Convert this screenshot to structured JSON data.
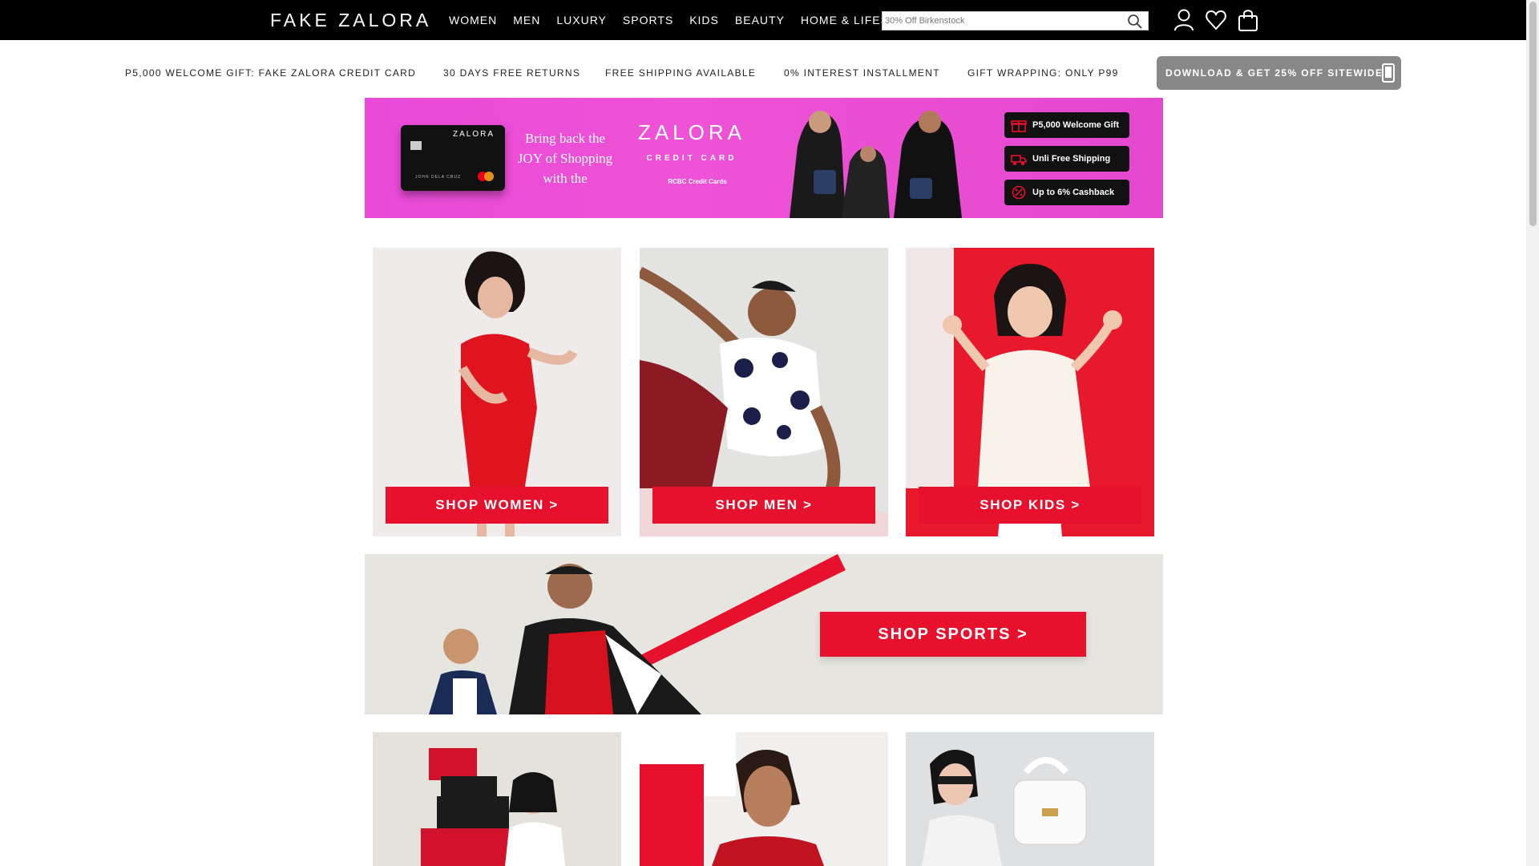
{
  "nav": {
    "logo": "FAKE ZALORA",
    "links": [
      "WOMEN",
      "MEN",
      "LUXURY",
      "SPORTS",
      "KIDS",
      "BEAUTY",
      "HOME & LIFESTYLE"
    ],
    "search_placeholder": "30% Off Birkenstock"
  },
  "usp": {
    "items": [
      "P5,000 WELCOME GIFT: FAKE ZALORA CREDIT CARD",
      "30 DAYS FREE RETURNS",
      "FREE SHIPPING AVAILABLE",
      "0% INTEREST INSTALLMENT",
      "GIFT WRAPPING: ONLY P99"
    ],
    "download_label": "DOWNLOAD & GET 25% OFF SITEWIDE"
  },
  "hero": {
    "card_brand": "ZALORA",
    "card_holder": "JOHN DELA CRUZ",
    "tagline": "Bring back the JOY of Shopping with the",
    "brand": "ZALORA",
    "sub": "CREDIT CARD",
    "bank": "RCBC Credit Cards",
    "perks": [
      "P5,000 Welcome Gift",
      "Unli Free Shipping",
      "Up to 6% Cashback"
    ]
  },
  "tiles": {
    "women": "SHOP WOMEN >",
    "men": "SHOP MEN >",
    "kids": "SHOP KIDS >",
    "sports": "SHOP SPORTS >"
  },
  "colors": {
    "accent_red": "#e8112d",
    "hero_pink": "#e94ad8",
    "nav_black": "#000000"
  },
  "icons": [
    "search-icon",
    "account-icon",
    "heart-icon",
    "bag-icon",
    "phone-icon",
    "gift-icon",
    "truck-icon",
    "cashback-icon"
  ]
}
